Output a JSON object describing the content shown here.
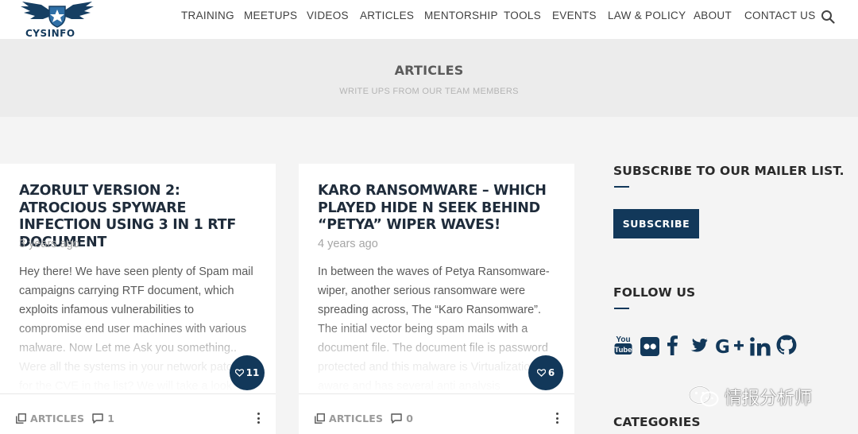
{
  "brand": {
    "name": "CYSINFO"
  },
  "nav": {
    "items": [
      "TRAINING",
      "MEETUPS",
      "VIDEOS",
      "ARTICLES",
      "MENTORSHIP",
      "TOOLS",
      "EVENTS",
      "LAW & POLICY",
      "ABOUT",
      "CONTACT US"
    ]
  },
  "banner": {
    "title": "ARTICLES",
    "subtitle": "WRITE UPS FROM OUR TEAM MEMBERS"
  },
  "posts": [
    {
      "title": "AZORULT VERSION 2: ATROCIOUS SPYWARE INFECTION USING 3 IN 1 RTF DOCUMENT",
      "date": "3 years ago",
      "excerpt": "Hey there! We have seen plenty of Spam mail campaigns carrying RTF document, which exploits infamous vulnerabilities to compromise end user machines with various malware. Now Let me Ask you something.. Were all the systems in your network patched for the CVE in the list? We will take a look",
      "likes": "11",
      "category": "ARTICLES",
      "comments": "1"
    },
    {
      "title": "KARO RANSOMWARE – WHICH PLAYED HIDE N SEEK BEHIND “PETYA” WIPER WAVES!",
      "date": "4 years ago",
      "excerpt": "In between the waves of Petya Ransomware-wiper, another serious ransomware were spreading across, The “Karo Ransomware”. The initial vector being spam mails with a document file. The document file is password protected and this malware is Virtualization aware and has several anti analysis techniques",
      "likes": "6",
      "category": "ARTICLES",
      "comments": "0"
    }
  ],
  "sidebar": {
    "mailer_heading": "SUBSCRIBE TO OUR MAILER LIST.",
    "subscribe_label": "SUBSCRIBE",
    "follow_heading": "FOLLOW US",
    "social_icons": [
      "youtube-icon",
      "flickr-icon",
      "facebook-icon",
      "twitter-icon",
      "google-plus-icon",
      "linkedin-icon",
      "github-icon"
    ],
    "categories_heading": "CATEGORIES"
  },
  "watermark": {
    "text": "情报分析师"
  },
  "colors": {
    "accent": "#12385a",
    "banner_bg": "#ececec",
    "page_bg": "#f4f4f4"
  }
}
